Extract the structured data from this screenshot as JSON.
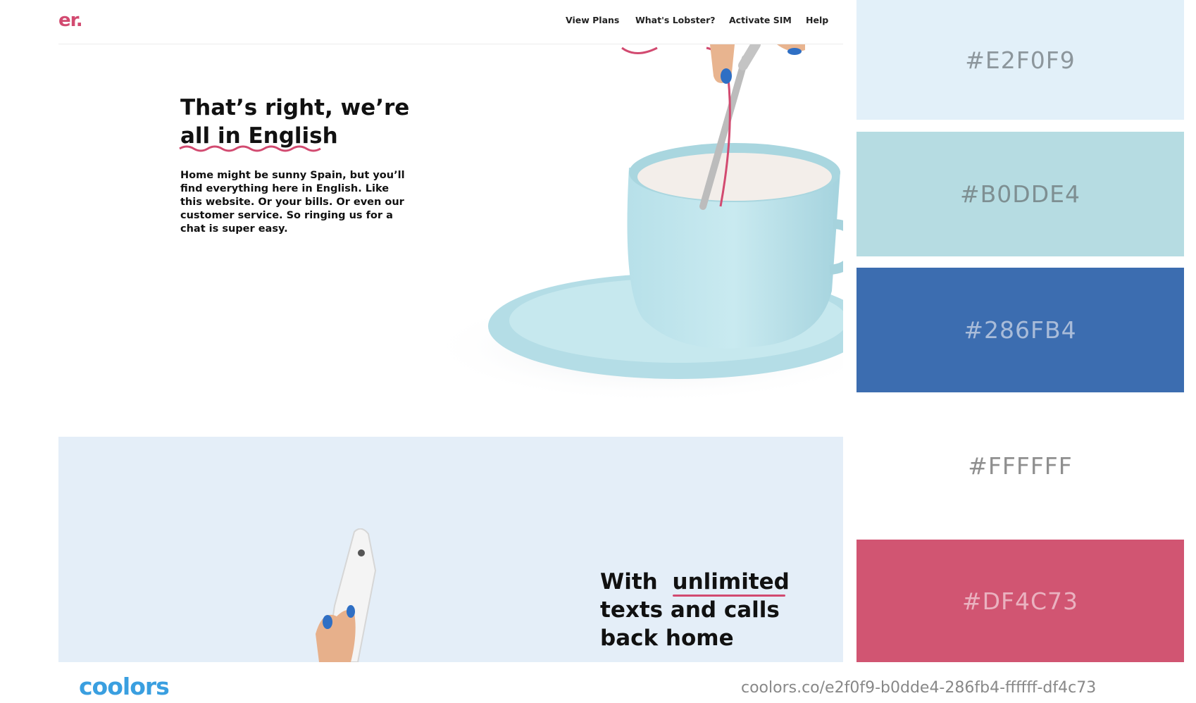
{
  "site": {
    "logo": "er.",
    "nav": [
      "View Plans",
      "What's Lobster?",
      "Activate SIM",
      "Help"
    ],
    "hero": {
      "title_line1": "That’s right, we’re",
      "title_line2": "all in English",
      "body": "Home might be sunny Spain, but you’ll find everything here in English. Like this website. Or your bills. Or even our customer service. So ringing us for a chat is super easy."
    },
    "band": {
      "line1_prefix": "With ",
      "line1_highlight": "unlimited",
      "line2": "texts and calls",
      "line3": "back home"
    }
  },
  "palette": [
    {
      "hex": "#E2F0F9",
      "bg": "#e2f0f9",
      "text": "#8c969c"
    },
    {
      "hex": "#B0DDE4",
      "bg": "#b6dce2",
      "text": "#7e8f92"
    },
    {
      "hex": "#286FB4",
      "bg": "#3c6db0",
      "text": "#a9bcd9"
    },
    {
      "hex": "#FFFFFF",
      "bg": "#ffffff",
      "text": "#8f8f8f"
    },
    {
      "hex": "#DF4C73",
      "bg": "#d15572",
      "text": "#eab2c0"
    }
  ],
  "footer": {
    "brand": "coolors",
    "url": "coolors.co/e2f0f9-b0dde4-286fb4-ffffff-df4c73"
  }
}
